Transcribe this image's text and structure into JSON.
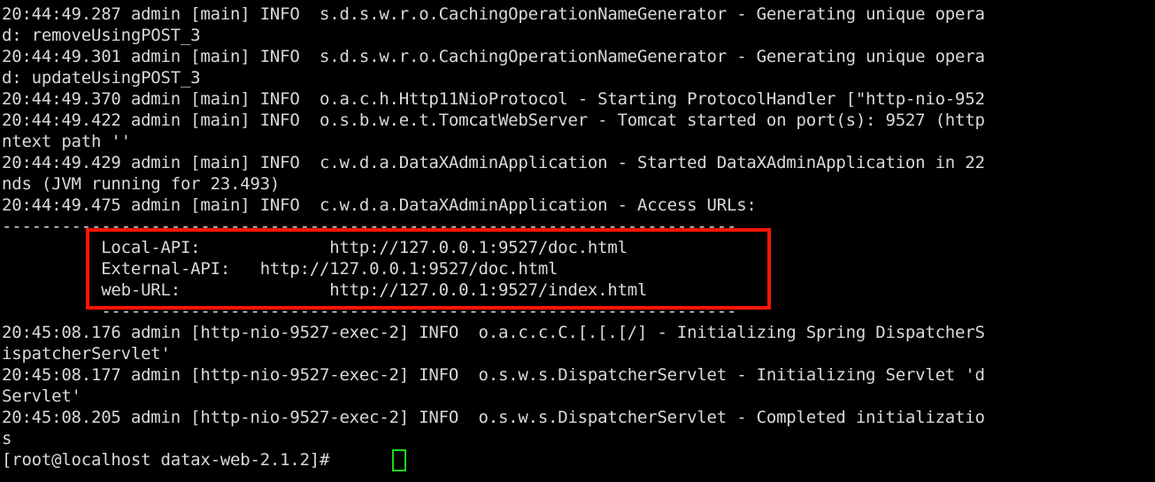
{
  "terminal": {
    "title": "root@localhost:~/datax-web-2.1.2",
    "background_color": "#000000",
    "text_color": "#d9d9de",
    "highlight_color": "#fb1505",
    "cursor_color": "#1bdb1b",
    "font_size_px": 19,
    "line_height_px": 24,
    "columns": 135,
    "rows": 17
  },
  "lines": [
    {
      "id": "line-01",
      "text": "20:44:49.287 admin [main] INFO  s.d.s.w.r.o.CachingOperationNameGenerator - Generating unique opera"
    },
    {
      "id": "line-02",
      "text": "d: removeUsingPOST_3"
    },
    {
      "id": "line-03",
      "text": "20:44:49.301 admin [main] INFO  s.d.s.w.r.o.CachingOperationNameGenerator - Generating unique opera"
    },
    {
      "id": "line-04",
      "text": "d: updateUsingPOST_3"
    },
    {
      "id": "line-05",
      "text": "20:44:49.370 admin [main] INFO  o.a.c.h.Http11NioProtocol - Starting ProtocolHandler [\"http-nio-952"
    },
    {
      "id": "line-06",
      "text": "20:44:49.422 admin [main] INFO  o.s.b.w.e.t.TomcatWebServer - Tomcat started on port(s): 9527 (http"
    },
    {
      "id": "line-07",
      "text": "ntext path ''"
    },
    {
      "id": "line-08",
      "text": "20:44:49.429 admin [main] INFO  c.w.d.a.DataXAdminApplication - Started DataXAdminApplication in 22"
    },
    {
      "id": "line-09",
      "text": "nds (JVM running for 23.493)"
    },
    {
      "id": "line-10",
      "text": "20:44:49.475 admin [main] INFO  c.w.d.a.DataXAdminApplication - Access URLs:"
    },
    {
      "id": "line-11",
      "text": "--------------------------------------------------------------------------"
    },
    {
      "id": "line-12",
      "text": "          Local-API:             http://127.0.0.1:9527/doc.html"
    },
    {
      "id": "line-13",
      "text": "          External-API:   http://127.0.0.1:9527/doc.html"
    },
    {
      "id": "line-14",
      "text": "          web-URL:               http://127.0.0.1:9527/index.html"
    },
    {
      "id": "line-15",
      "text": "          ----------------------------------------------------------------"
    },
    {
      "id": "line-16",
      "text": "20:45:08.176 admin [http-nio-9527-exec-2] INFO  o.a.c.c.C.[.[.[/] - Initializing Spring DispatcherS"
    },
    {
      "id": "line-17",
      "text": "ispatcherServlet'"
    },
    {
      "id": "line-18",
      "text": "20:45:08.177 admin [http-nio-9527-exec-2] INFO  o.s.w.s.DispatcherServlet - Initializing Servlet 'd"
    },
    {
      "id": "line-19",
      "text": "Servlet'"
    },
    {
      "id": "line-20",
      "text": "20:45:08.205 admin [http-nio-9527-exec-2] INFO  o.s.w.s.DispatcherServlet - Completed initializatio"
    },
    {
      "id": "line-21",
      "text": "s"
    },
    {
      "id": "line-22",
      "text": "[root@localhost datax-web-2.1.2]# "
    }
  ],
  "access_urls": {
    "local_api_label": "Local-API:",
    "local_api_url": "http://127.0.0.1:9527/doc.html",
    "external_api_label": "External-API:",
    "external_api_url": "http://127.0.0.1:9527/doc.html",
    "web_url_label": "web-URL:",
    "web_url_url": "http://127.0.0.1:9527/index.html"
  },
  "prompt": {
    "user": "root",
    "host": "localhost",
    "directory": "datax-web-2.1.2",
    "symbol": "#",
    "full": "[root@localhost datax-web-2.1.2]# "
  },
  "server": {
    "port": "9527",
    "application": "DataXAdminApplication",
    "startup_seconds": "22",
    "jvm_running_for": "23.493"
  }
}
